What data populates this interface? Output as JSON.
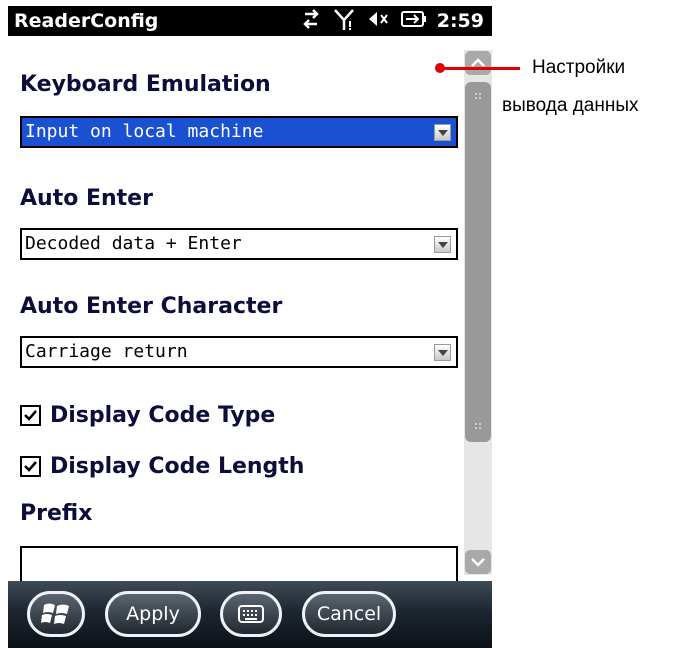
{
  "statusbar": {
    "app_title": "ReaderConfig",
    "time": "2:59",
    "icons": [
      "sync-icon",
      "signal-icon",
      "speaker-muted-icon",
      "battery-charging-icon"
    ]
  },
  "form": {
    "keyboard_emulation": {
      "label": "Keyboard Emulation",
      "value": "Input on local machine"
    },
    "auto_enter": {
      "label": "Auto Enter",
      "value": "Decoded data + Enter"
    },
    "auto_enter_character": {
      "label": "Auto Enter Character",
      "value": "Carriage return"
    },
    "display_code_type": {
      "label": "Display Code Type",
      "checked": true
    },
    "display_code_length": {
      "label": "Display Code Length",
      "checked": true
    },
    "prefix": {
      "label": "Prefix",
      "value": ""
    }
  },
  "bottombar": {
    "apply_label": "Apply",
    "cancel_label": "Cancel"
  },
  "annotation": {
    "line1": "Настройки",
    "line2": "вывода данных",
    "color": "#e00000"
  },
  "colors": {
    "selection": "#1a51d2",
    "heading": "#0d0d3c"
  }
}
